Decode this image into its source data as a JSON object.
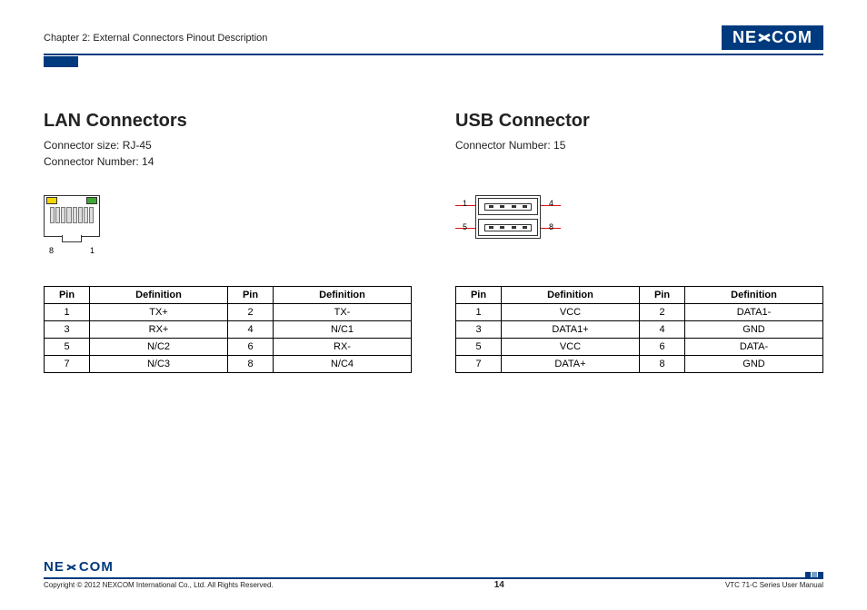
{
  "header": {
    "chapter": "Chapter 2: External Connectors Pinout Description",
    "logo_text_left": "NE",
    "logo_text_right": "COM"
  },
  "lan": {
    "title": "LAN Connectors",
    "size": "Connector size: RJ-45",
    "number": "Connector Number: 14",
    "pinlabel_left": "8",
    "pinlabel_right": "1",
    "headers": {
      "pin": "Pin",
      "def": "Definition"
    },
    "rows": [
      {
        "p1": "1",
        "d1": "TX+",
        "p2": "2",
        "d2": "TX-"
      },
      {
        "p1": "3",
        "d1": "RX+",
        "p2": "4",
        "d2": "N/C1"
      },
      {
        "p1": "5",
        "d1": "N/C2",
        "p2": "6",
        "d2": "RX-"
      },
      {
        "p1": "7",
        "d1": "N/C3",
        "p2": "8",
        "d2": "N/C4"
      }
    ]
  },
  "usb": {
    "title": "USB Connector",
    "number": "Connector Number: 15",
    "n1": "1",
    "n4": "4",
    "n5": "5",
    "n8": "8",
    "headers": {
      "pin": "Pin",
      "def": "Definition"
    },
    "rows": [
      {
        "p1": "1",
        "d1": "VCC",
        "p2": "2",
        "d2": "DATA1-"
      },
      {
        "p1": "3",
        "d1": "DATA1+",
        "p2": "4",
        "d2": "GND"
      },
      {
        "p1": "5",
        "d1": "VCC",
        "p2": "6",
        "d2": "DATA-"
      },
      {
        "p1": "7",
        "d1": "DATA+",
        "p2": "8",
        "d2": "GND"
      }
    ]
  },
  "footer": {
    "copyright": "Copyright © 2012 NEXCOM International Co., Ltd. All Rights Reserved.",
    "page": "14",
    "doc": "VTC 71-C Series User Manual"
  }
}
